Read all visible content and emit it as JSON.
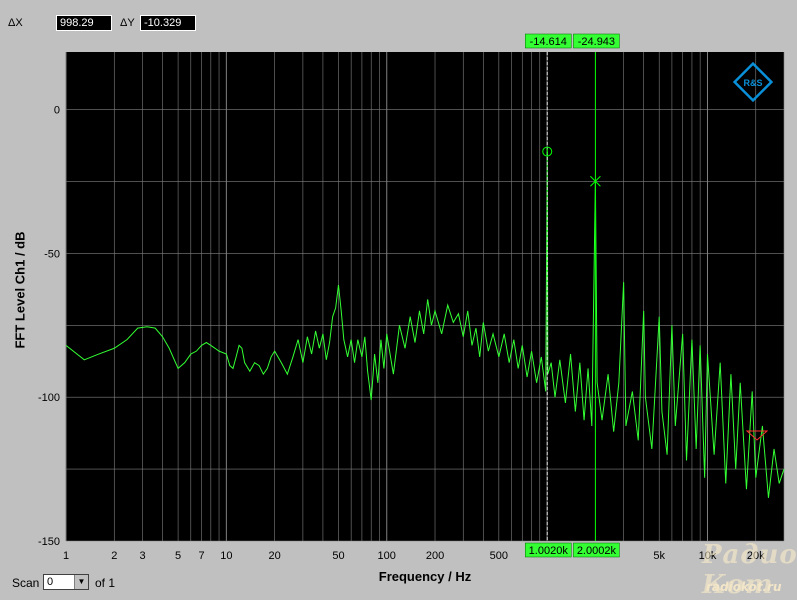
{
  "header": {
    "dx_label": "ΔX",
    "dx_value": "998.29",
    "dy_label": "ΔY",
    "dy_value": "-10.329"
  },
  "footer": {
    "scan_label": "Scan",
    "scan_value": "0",
    "scan_of": "of 1"
  },
  "watermark": {
    "main": "Радио Кот",
    "sub": "radiokot.ru"
  },
  "logo_text": "R&S",
  "colors": {
    "plot_bg": "#000000",
    "trace": "#33ff33",
    "grid": "#808080",
    "marker": "#00ff00",
    "marker_box": "#33ff33",
    "logo": "#0a90d8",
    "window_bg": "#c0c0c0"
  },
  "chart_data": {
    "type": "line",
    "xlabel": "Frequency / Hz",
    "ylabel": "FFT Level Ch1 / dB",
    "xscale": "log",
    "xlim": [
      1,
      30000
    ],
    "ylim": [
      -150,
      20
    ],
    "x_ticks": [
      {
        "v": 1,
        "label": "1"
      },
      {
        "v": 2,
        "label": "2"
      },
      {
        "v": 3,
        "label": "3"
      },
      {
        "v": 5,
        "label": "5"
      },
      {
        "v": 7,
        "label": "7"
      },
      {
        "v": 10,
        "label": "10"
      },
      {
        "v": 20,
        "label": "20"
      },
      {
        "v": 50,
        "label": "50"
      },
      {
        "v": 100,
        "label": "100"
      },
      {
        "v": 200,
        "label": "200"
      },
      {
        "v": 500,
        "label": "500"
      },
      {
        "v": 5000,
        "label": "5k"
      },
      {
        "v": 10000,
        "label": "10k"
      },
      {
        "v": 20000,
        "label": "20k"
      }
    ],
    "y_ticks": [
      0,
      -50,
      -100,
      -150
    ],
    "grid": true,
    "series": [
      {
        "points": [
          [
            1,
            -82
          ],
          [
            1.3,
            -87
          ],
          [
            1.6,
            -85
          ],
          [
            2,
            -83
          ],
          [
            2.4,
            -80
          ],
          [
            2.8,
            -76
          ],
          [
            3.2,
            -75.5
          ],
          [
            3.6,
            -76
          ],
          [
            4.0,
            -79
          ],
          [
            4.4,
            -83
          ],
          [
            5,
            -90
          ],
          [
            5.5,
            -88
          ],
          [
            6,
            -85
          ],
          [
            6.5,
            -84
          ],
          [
            7,
            -82
          ],
          [
            7.5,
            -81
          ],
          [
            8,
            -82
          ],
          [
            8.5,
            -83
          ],
          [
            9,
            -84
          ],
          [
            10,
            -85
          ],
          [
            10.5,
            -89
          ],
          [
            11,
            -90
          ],
          [
            11.5,
            -86
          ],
          [
            12,
            -82
          ],
          [
            12.5,
            -83
          ],
          [
            13,
            -88
          ],
          [
            14,
            -91
          ],
          [
            15,
            -88
          ],
          [
            16,
            -89
          ],
          [
            17,
            -92
          ],
          [
            18,
            -90
          ],
          [
            19,
            -86
          ],
          [
            20,
            -84
          ],
          [
            22,
            -88
          ],
          [
            24,
            -92
          ],
          [
            26,
            -86
          ],
          [
            28,
            -80
          ],
          [
            30,
            -88
          ],
          [
            32,
            -79
          ],
          [
            34,
            -85
          ],
          [
            36,
            -77
          ],
          [
            38,
            -83
          ],
          [
            40,
            -78
          ],
          [
            42,
            -87
          ],
          [
            44,
            -81
          ],
          [
            46,
            -72
          ],
          [
            48,
            -69
          ],
          [
            50,
            -61
          ],
          [
            52,
            -70
          ],
          [
            54,
            -80
          ],
          [
            57,
            -86
          ],
          [
            60,
            -80
          ],
          [
            63,
            -88
          ],
          [
            66,
            -80
          ],
          [
            70,
            -86
          ],
          [
            73,
            -79
          ],
          [
            76,
            -91
          ],
          [
            80,
            -101
          ],
          [
            84,
            -85
          ],
          [
            88,
            -95
          ],
          [
            92,
            -80
          ],
          [
            96,
            -90
          ],
          [
            100,
            -78
          ],
          [
            110,
            -92
          ],
          [
            120,
            -75
          ],
          [
            130,
            -83
          ],
          [
            140,
            -72
          ],
          [
            150,
            -81
          ],
          [
            160,
            -70
          ],
          [
            170,
            -78
          ],
          [
            180,
            -66
          ],
          [
            190,
            -75
          ],
          [
            200,
            -70
          ],
          [
            220,
            -78
          ],
          [
            240,
            -68
          ],
          [
            260,
            -74
          ],
          [
            280,
            -71
          ],
          [
            300,
            -79
          ],
          [
            320,
            -70
          ],
          [
            340,
            -82
          ],
          [
            360,
            -76
          ],
          [
            380,
            -86
          ],
          [
            400,
            -74
          ],
          [
            430,
            -84
          ],
          [
            460,
            -78
          ],
          [
            500,
            -86
          ],
          [
            540,
            -78
          ],
          [
            580,
            -88
          ],
          [
            620,
            -80
          ],
          [
            660,
            -90
          ],
          [
            700,
            -82
          ],
          [
            750,
            -93
          ],
          [
            800,
            -84
          ],
          [
            860,
            -95
          ],
          [
            920,
            -86
          ],
          [
            980,
            -98
          ],
          [
            1002,
            -14.6
          ],
          [
            1010,
            -92
          ],
          [
            1060,
            -88
          ],
          [
            1120,
            -100
          ],
          [
            1200,
            -87
          ],
          [
            1300,
            -102
          ],
          [
            1400,
            -85
          ],
          [
            1500,
            -105
          ],
          [
            1600,
            -88
          ],
          [
            1700,
            -108
          ],
          [
            1800,
            -90
          ],
          [
            1900,
            -110
          ],
          [
            2000,
            -24.9
          ],
          [
            2050,
            -95
          ],
          [
            2200,
            -108
          ],
          [
            2400,
            -92
          ],
          [
            2600,
            -112
          ],
          [
            2800,
            -95
          ],
          [
            3000,
            -60
          ],
          [
            3100,
            -110
          ],
          [
            3400,
            -98
          ],
          [
            3700,
            -115
          ],
          [
            4000,
            -70
          ],
          [
            4100,
            -100
          ],
          [
            4500,
            -118
          ],
          [
            5000,
            -72
          ],
          [
            5200,
            -105
          ],
          [
            5600,
            -120
          ],
          [
            6000,
            -75
          ],
          [
            6300,
            -110
          ],
          [
            7000,
            -78
          ],
          [
            7400,
            -122
          ],
          [
            8000,
            -80
          ],
          [
            8500,
            -118
          ],
          [
            9000,
            -82
          ],
          [
            9600,
            -128
          ],
          [
            10000,
            -85
          ],
          [
            11000,
            -120
          ],
          [
            12000,
            -88
          ],
          [
            13000,
            -130
          ],
          [
            14000,
            -92
          ],
          [
            15000,
            -125
          ],
          [
            16000,
            -95
          ],
          [
            17500,
            -132
          ],
          [
            19000,
            -98
          ],
          [
            20000,
            -128
          ],
          [
            22000,
            -110
          ],
          [
            24000,
            -135
          ],
          [
            26000,
            -118
          ],
          [
            28000,
            -130
          ],
          [
            30000,
            -125
          ]
        ]
      }
    ],
    "markers": [
      {
        "x": 1002,
        "y": -14.614,
        "symbol": "circle",
        "top_label": "-14.614",
        "bottom_label": "1.0020k",
        "style": "dashed"
      },
      {
        "x": 2000.2,
        "y": -24.943,
        "symbol": "cross",
        "top_label": "-24.943",
        "bottom_label": "2.0002k",
        "style": "solid"
      }
    ]
  }
}
